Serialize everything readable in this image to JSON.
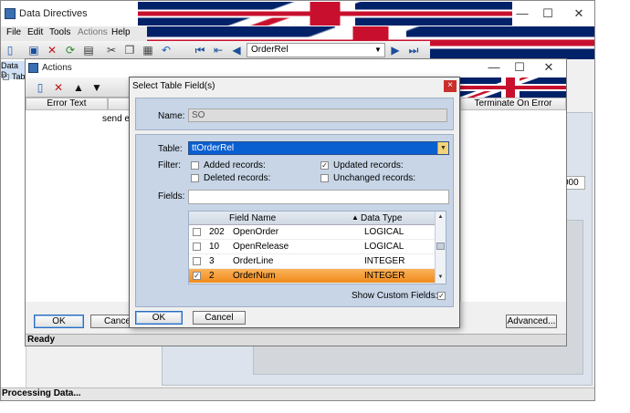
{
  "main_window": {
    "title": "Data Directives",
    "menu": [
      "File",
      "Edit",
      "Tools",
      "Actions",
      "Help"
    ],
    "navigator_value": "OrderRel",
    "tree_labels": [
      "Data D",
      "Tab"
    ],
    "side_value": "000",
    "status": "Processing Data..."
  },
  "actions_window": {
    "title": "Actions",
    "columns": [
      "Error Text",
      "Terminate On Error"
    ],
    "first_cell": "send e",
    "ok_label": "OK",
    "cancel_label": "Cancel",
    "advanced_label": "Advanced...",
    "status": "Ready"
  },
  "dialog": {
    "title": "Select Table Field(s)",
    "name_label": "Name:",
    "name_value": "SO",
    "table_label": "Table:",
    "table_value": "ttOrderRel",
    "filter_label": "Filter:",
    "filters": [
      {
        "label": "Added records:",
        "checked": false
      },
      {
        "label": "Updated records:",
        "checked": true
      },
      {
        "label": "Deleted records:",
        "checked": false
      },
      {
        "label": "Unchanged records:",
        "checked": false
      }
    ],
    "fields_label": "Fields:",
    "fields_search": "",
    "grid_headers": {
      "name": "Field Name",
      "type": "Data Type"
    },
    "rows": [
      {
        "num": "202",
        "name": "OpenOrder",
        "type": "LOGICAL",
        "checked": false,
        "selected": false
      },
      {
        "num": "10",
        "name": "OpenRelease",
        "type": "LOGICAL",
        "checked": false,
        "selected": false
      },
      {
        "num": "3",
        "name": "OrderLine",
        "type": "INTEGER",
        "checked": false,
        "selected": false
      },
      {
        "num": "2",
        "name": "OrderNum",
        "type": "INTEGER",
        "checked": true,
        "selected": true
      }
    ],
    "show_custom_label": "Show Custom Fields:",
    "show_custom_checked": true,
    "ok_label": "OK",
    "cancel_label": "Cancel",
    "close_glyph": "×"
  },
  "colors": {
    "selection_blue": "#0a5fd0",
    "row_highlight": "#f08a1c",
    "close_red": "#c9302c"
  }
}
